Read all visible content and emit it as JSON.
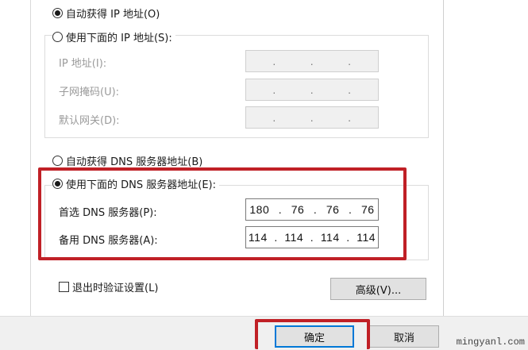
{
  "ip_section": {
    "auto_ip_label": "自动获得 IP 地址(O)",
    "manual_ip_label": "使用下面的 IP 地址(S):",
    "fields": [
      {
        "label": "IP 地址(I):",
        "octets": [
          "",
          "",
          "",
          ""
        ]
      },
      {
        "label": "子网掩码(U):",
        "octets": [
          "",
          "",
          "",
          ""
        ]
      },
      {
        "label": "默认网关(D):",
        "octets": [
          "",
          "",
          "",
          ""
        ]
      }
    ]
  },
  "dns_section": {
    "auto_dns_label": "自动获得 DNS 服务器地址(B)",
    "manual_dns_label": "使用下面的 DNS 服务器地址(E):",
    "fields": [
      {
        "label": "首选 DNS 服务器(P):",
        "octets": [
          "180",
          "76",
          "76",
          "76"
        ]
      },
      {
        "label": "备用 DNS 服务器(A):",
        "octets": [
          "114",
          "114",
          "114",
          "114"
        ]
      }
    ]
  },
  "validate_on_exit_label": "退出时验证设置(L)",
  "advanced_button_label": "高级(V)...",
  "ok_button_label": "确定",
  "cancel_button_label": "取消",
  "watermark_text": "mingyanl.com",
  "colors": {
    "highlight": "#c02026",
    "focus_border": "#0078d7"
  }
}
